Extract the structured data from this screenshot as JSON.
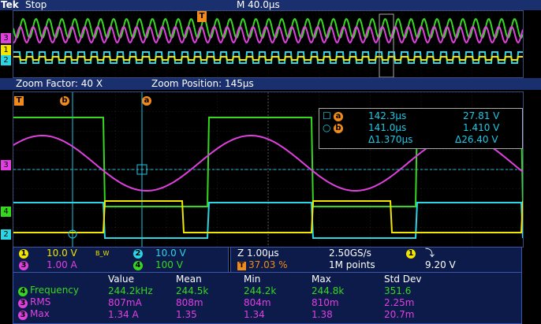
{
  "header": {
    "brand": "Tek",
    "run_state": "Stop",
    "timebase": "M 40.0µs",
    "trigger_marker": "T"
  },
  "zoom": {
    "factor": "Zoom Factor: 40 X",
    "position": "Zoom Position: 145µs"
  },
  "channels_left_markers": [
    "3",
    "1",
    "2"
  ],
  "zoom_left_markers": [
    "3",
    "4",
    "2"
  ],
  "cursor_markers": {
    "t": "T",
    "b": "b",
    "a": "a"
  },
  "cursor_readout": {
    "a_time": "142.3µs",
    "a_value": "27.81 V",
    "b_time": "141.0µs",
    "b_value": "1.410 V",
    "delta_time": "Δ1.370µs",
    "delta_value": "Δ26.40 V"
  },
  "channel_settings": {
    "ch1": {
      "num": "1",
      "scale": "10.0 V",
      "bw": "B_W"
    },
    "ch2": {
      "num": "2",
      "scale": "10.0 V"
    },
    "ch3": {
      "num": "3",
      "scale": "1.00 A"
    },
    "ch4": {
      "num": "4",
      "scale": "100 V"
    }
  },
  "acquisition": {
    "zoom_scale": "Z 1.00µs",
    "sample_rate": "2.50GS/s",
    "trigger_pos": "37.03 %",
    "record_length": "1M points",
    "trigger_ch": "1",
    "trigger_slope": "⤵",
    "trigger_level": "9.20 V"
  },
  "measurements": {
    "headers": [
      "Value",
      "Mean",
      "Min",
      "Max",
      "Std Dev"
    ],
    "rows": [
      {
        "ch": "4",
        "name": "Frequency",
        "values": [
          "244.2kHz",
          "244.5k",
          "244.2k",
          "244.8k",
          "351.6"
        ]
      },
      {
        "ch": "3",
        "name": "RMS",
        "values": [
          "807mA",
          "808m",
          "804m",
          "810m",
          "2.25m"
        ]
      },
      {
        "ch": "3",
        "name": "Max",
        "values": [
          "1.34 A",
          "1.35",
          "1.34",
          "1.38",
          "20.7m"
        ]
      }
    ]
  },
  "colors": {
    "ch1": "#f2e600",
    "ch2": "#2ad6e6",
    "ch3": "#e040e0",
    "ch4": "#35d81f",
    "cursor": "#1ec8e6",
    "marker_orange": "#f08a1a"
  }
}
